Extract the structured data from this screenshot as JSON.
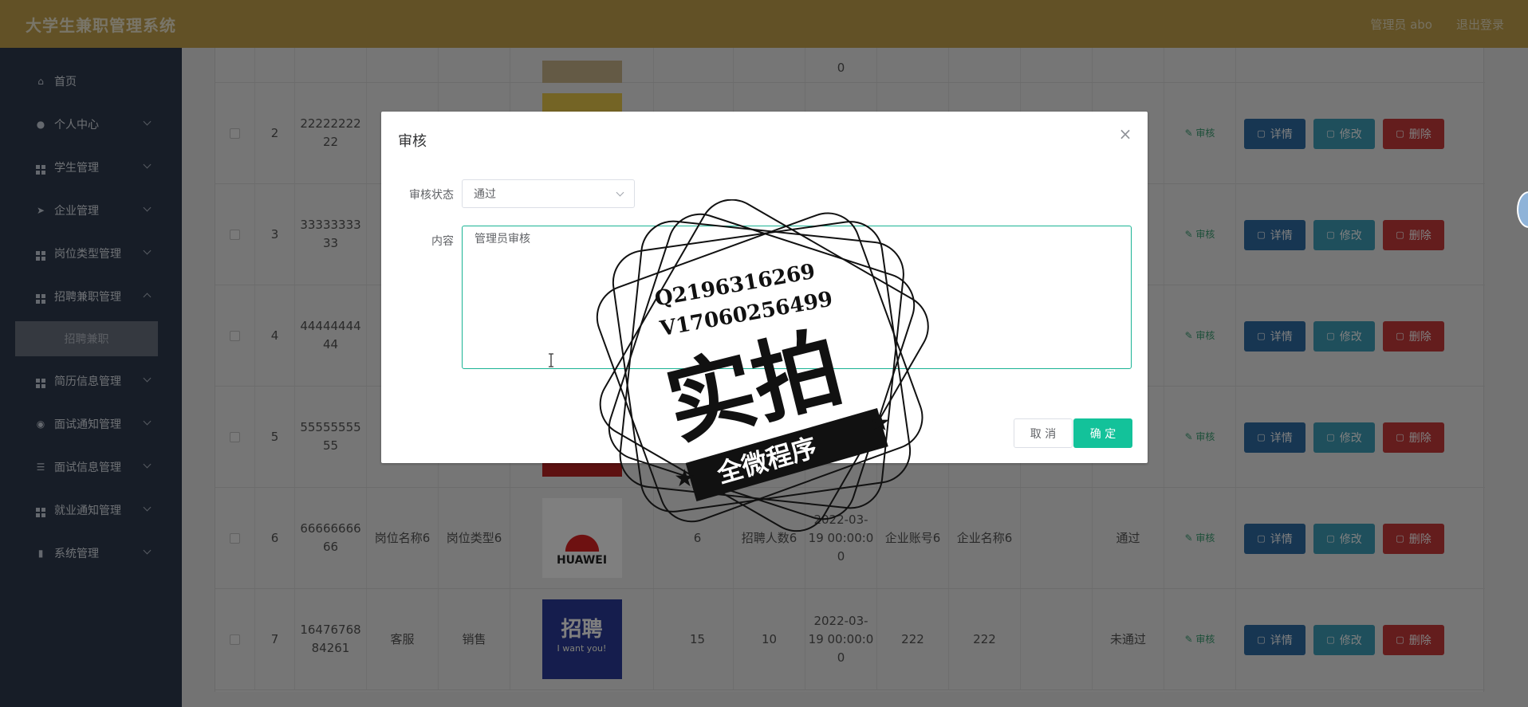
{
  "header": {
    "title": "大学生兼职管理系统",
    "user": "管理员 abo",
    "logout": "退出登录"
  },
  "sidebar": {
    "items": [
      {
        "label": "首页",
        "icon": "home-icon"
      },
      {
        "label": "个人中心",
        "icon": "user-icon"
      },
      {
        "label": "学生管理",
        "icon": "grid-icon"
      },
      {
        "label": "企业管理",
        "icon": "send-icon"
      },
      {
        "label": "岗位类型管理",
        "icon": "grid-icon"
      },
      {
        "label": "招聘兼职管理",
        "icon": "grid-icon"
      },
      {
        "label": "简历信息管理",
        "icon": "grid-icon"
      },
      {
        "label": "面试通知管理",
        "icon": "location-icon"
      },
      {
        "label": "面试信息管理",
        "icon": "sliders-icon"
      },
      {
        "label": "就业通知管理",
        "icon": "grid-icon"
      },
      {
        "label": "系统管理",
        "icon": "bar-chart-icon"
      }
    ],
    "submenu_active": "招聘兼职"
  },
  "table": {
    "actions": {
      "review": "审核",
      "detail": "详情",
      "edit": "修改",
      "delete": "删除"
    },
    "top_partial": "0",
    "rows": [
      {
        "idx": "2",
        "no_a": "22222222",
        "no_b": "22",
        "job": "",
        "type": "",
        "count": "",
        "recruit": "",
        "time_a": "",
        "time_b": "",
        "time_c": "",
        "acct": "",
        "company": "",
        "status": ""
      },
      {
        "idx": "3",
        "no_a": "33333333",
        "no_b": "33",
        "job": "",
        "type": "",
        "count": "",
        "recruit": "",
        "time_a": "",
        "time_b": "",
        "time_c": "",
        "acct": "",
        "company": "",
        "status": ""
      },
      {
        "idx": "4",
        "no_a": "44444444",
        "no_b": "44",
        "job": "",
        "type": "",
        "count": "",
        "recruit": "",
        "time_a": "",
        "time_b": "",
        "time_c": "",
        "acct": "",
        "company": "",
        "status": ""
      },
      {
        "idx": "5",
        "no_a": "55555555",
        "no_b": "55",
        "job": "",
        "type": "",
        "count": "",
        "recruit": "",
        "time_a": "",
        "time_b": "",
        "time_c": "",
        "acct": "",
        "company": "",
        "status": ""
      },
      {
        "idx": "6",
        "no_a": "66666666",
        "no_b": "66",
        "job": "岗位名称6",
        "type": "岗位类型6",
        "count": "6",
        "recruit": "招聘人数6",
        "time_a": "2022-03-",
        "time_b": "19 00:00:0",
        "time_c": "0",
        "acct": "企业账号6",
        "company": "企业名称6",
        "status": "通过"
      },
      {
        "idx": "7",
        "no_a": "16476768",
        "no_b": "84261",
        "job": "客服",
        "type": "销售",
        "count": "15",
        "recruit": "10",
        "time_a": "2022-03-",
        "time_b": "19 00:00:0",
        "time_c": "0",
        "acct": "222",
        "company": "222",
        "status": "未通过"
      }
    ],
    "logo_text": "HUAWEI",
    "poster_title": "招聘",
    "poster_sub": "I want you!"
  },
  "dialog": {
    "title": "审核",
    "status_label": "审核状态",
    "status_value": "通过",
    "content_label": "内容",
    "content_value": "管理员审核",
    "cancel": "取 消",
    "confirm": "确 定"
  },
  "watermark": {
    "line1": "Q2196316269",
    "line2": "V17060256499",
    "main": "实拍",
    "banner": "全微程序"
  }
}
